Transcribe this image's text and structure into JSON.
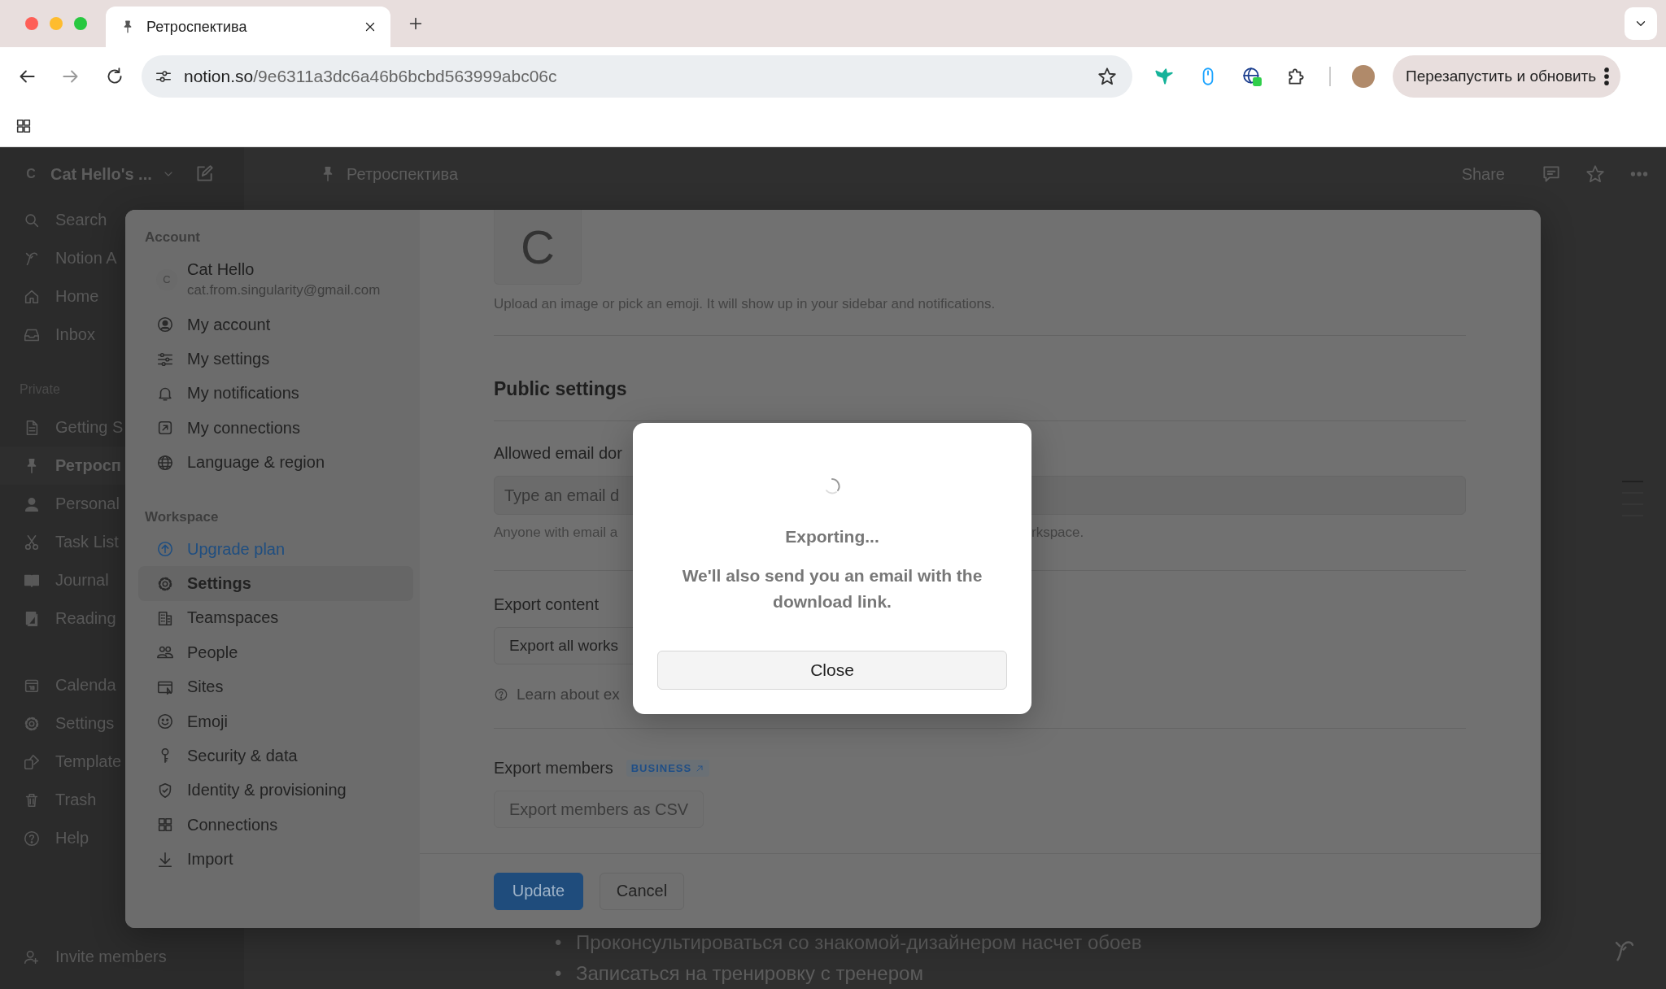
{
  "browser": {
    "tab": {
      "title": "Ретроспектива"
    },
    "address": {
      "host": "notion.so",
      "path": "/9e6311a3dc6a46b6bcbd563999abc06c"
    },
    "update_button": "Перезапустить и обновить"
  },
  "topbar": {
    "workspace_initial": "C",
    "workspace": "Cat Hello's ...",
    "page": "Ретроспектива",
    "share": "Share"
  },
  "sidebar": {
    "items": [
      {
        "label": "Search"
      },
      {
        "label": "Notion A"
      },
      {
        "label": "Home"
      },
      {
        "label": "Inbox"
      }
    ],
    "private_heading": "Private",
    "private_items": [
      {
        "label": "Getting S",
        "selected": false
      },
      {
        "label": "Ретросп",
        "selected": true
      },
      {
        "label": "Personal",
        "selected": false
      },
      {
        "label": "Task List",
        "selected": false
      },
      {
        "label": "Journal",
        "selected": false
      },
      {
        "label": "Reading",
        "selected": false
      }
    ],
    "bottom_items": [
      {
        "label": "Calenda"
      },
      {
        "label": "Settings"
      },
      {
        "label": "Template"
      },
      {
        "label": "Trash"
      },
      {
        "label": "Help"
      }
    ],
    "invite": "Invite members"
  },
  "page": {
    "bullets": [
      {
        "marker": "•",
        "text": "Проконсультироваться со знакомой-дизайнером насчет обоев"
      },
      {
        "marker": "•",
        "text": "Записаться на тренировку с тренером"
      }
    ]
  },
  "settings": {
    "account_heading": "Account",
    "user": {
      "initial": "C",
      "name": "Cat Hello",
      "email": "cat.from.singularity@gmail.com"
    },
    "account_items": [
      {
        "label": "My account",
        "selected": false
      },
      {
        "label": "My settings",
        "selected": false
      },
      {
        "label": "My notifications",
        "selected": false
      },
      {
        "label": "My connections",
        "selected": false
      },
      {
        "label": "Language & region",
        "selected": false
      }
    ],
    "workspace_heading": "Workspace",
    "workspace_items": [
      {
        "label": "Upgrade plan",
        "kind": "upgrade",
        "selected": false
      },
      {
        "label": "Settings",
        "kind": "page",
        "selected": true
      },
      {
        "label": "Teamspaces",
        "kind": "page",
        "selected": false
      },
      {
        "label": "People",
        "kind": "page",
        "selected": false
      },
      {
        "label": "Sites",
        "kind": "page",
        "selected": false
      },
      {
        "label": "Emoji",
        "kind": "page",
        "selected": false
      },
      {
        "label": "Security & data",
        "kind": "page",
        "selected": false
      },
      {
        "label": "Identity & provisioning",
        "kind": "page",
        "selected": false
      },
      {
        "label": "Connections",
        "kind": "page",
        "selected": false
      },
      {
        "label": "Import",
        "kind": "page",
        "selected": false
      }
    ],
    "content": {
      "avatar_initial": "C",
      "avatar_hint": "Upload an image or pick an emoji. It will show up in your sidebar and notifications.",
      "public_heading": "Public settings",
      "allowed_label": "Allowed email dor",
      "allowed_placeholder": "Type an email d",
      "allowed_help_left": "Anyone with email a",
      "allowed_help_right": "rkspace.",
      "export_label": "Export content",
      "export_button": "Export all works",
      "learn_link": "Learn about ex",
      "members_label": "Export members",
      "members_badge": "BUSINESS",
      "members_button": {
        "label": "Export members as CSV",
        "disabled": true
      }
    },
    "footer": {
      "update": "Update",
      "cancel": "Cancel"
    }
  },
  "dialog": {
    "title": "Exporting...",
    "message": "We'll also send you an email with the download link.",
    "close": "Close"
  }
}
